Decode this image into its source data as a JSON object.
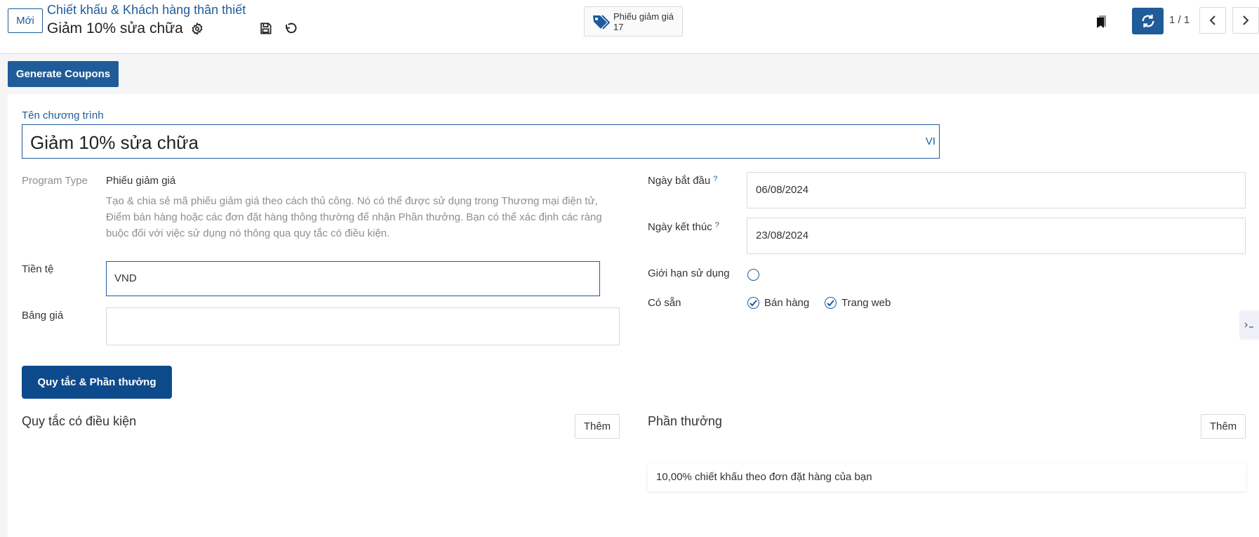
{
  "header": {
    "new_label": "Mới",
    "breadcrumb": "Chiết khấu & Khách hàng thân thiết",
    "record_title": "Giảm 10% sửa chữa",
    "smart_button": {
      "label": "Phiếu giảm giá",
      "count": "17"
    },
    "pager": "1 / 1"
  },
  "actions": {
    "generate_label": "Generate Coupons"
  },
  "form": {
    "program_name_label": "Tên chương trình",
    "program_name": "Giảm 10% sửa chữa",
    "lang_code": "VI",
    "program_type_label": "Program Type",
    "program_type_value": "Phiếu giảm giá",
    "program_type_description": "Tạo & chia sẻ mã phiếu giảm giá theo cách thủ công. Nó có thể được sử dụng trong Thương mại điện tử, Điểm bán hàng hoặc các đơn đặt hàng thông thường để nhận Phần thưởng. Bạn có thể xác định các ràng buộc đối với việc sử dụng nó thông qua quy tắc có điều kiện.",
    "currency_label": "Tiền tệ",
    "currency_value": "VND",
    "pricelist_label": "Bảng giá",
    "pricelist_value": "",
    "start_date_label": "Ngày bắt đầu",
    "start_date": "06/08/2024",
    "end_date_label": "Ngày kết thúc",
    "end_date": "23/08/2024",
    "help_mark": "?",
    "usage_limit_label": "Giới hạn sử dụng",
    "available_label": "Có sẵn",
    "available_sales": "Bán hàng",
    "available_website": "Trang web"
  },
  "tabs": {
    "rules_rewards": "Quy tắc & Phần thưởng"
  },
  "rules": {
    "title": "Quy tắc có điều kiện",
    "add_label": "Thêm"
  },
  "rewards": {
    "title": "Phần thưởng",
    "add_label": "Thêm",
    "items": [
      "10,00% chiết khấu theo đơn đặt hàng của bạn"
    ]
  },
  "colors": {
    "primary": "#1f5c99",
    "tab_active": "#0d4a8c",
    "muted_text": "#8a8f96",
    "border": "#d8dadd"
  }
}
